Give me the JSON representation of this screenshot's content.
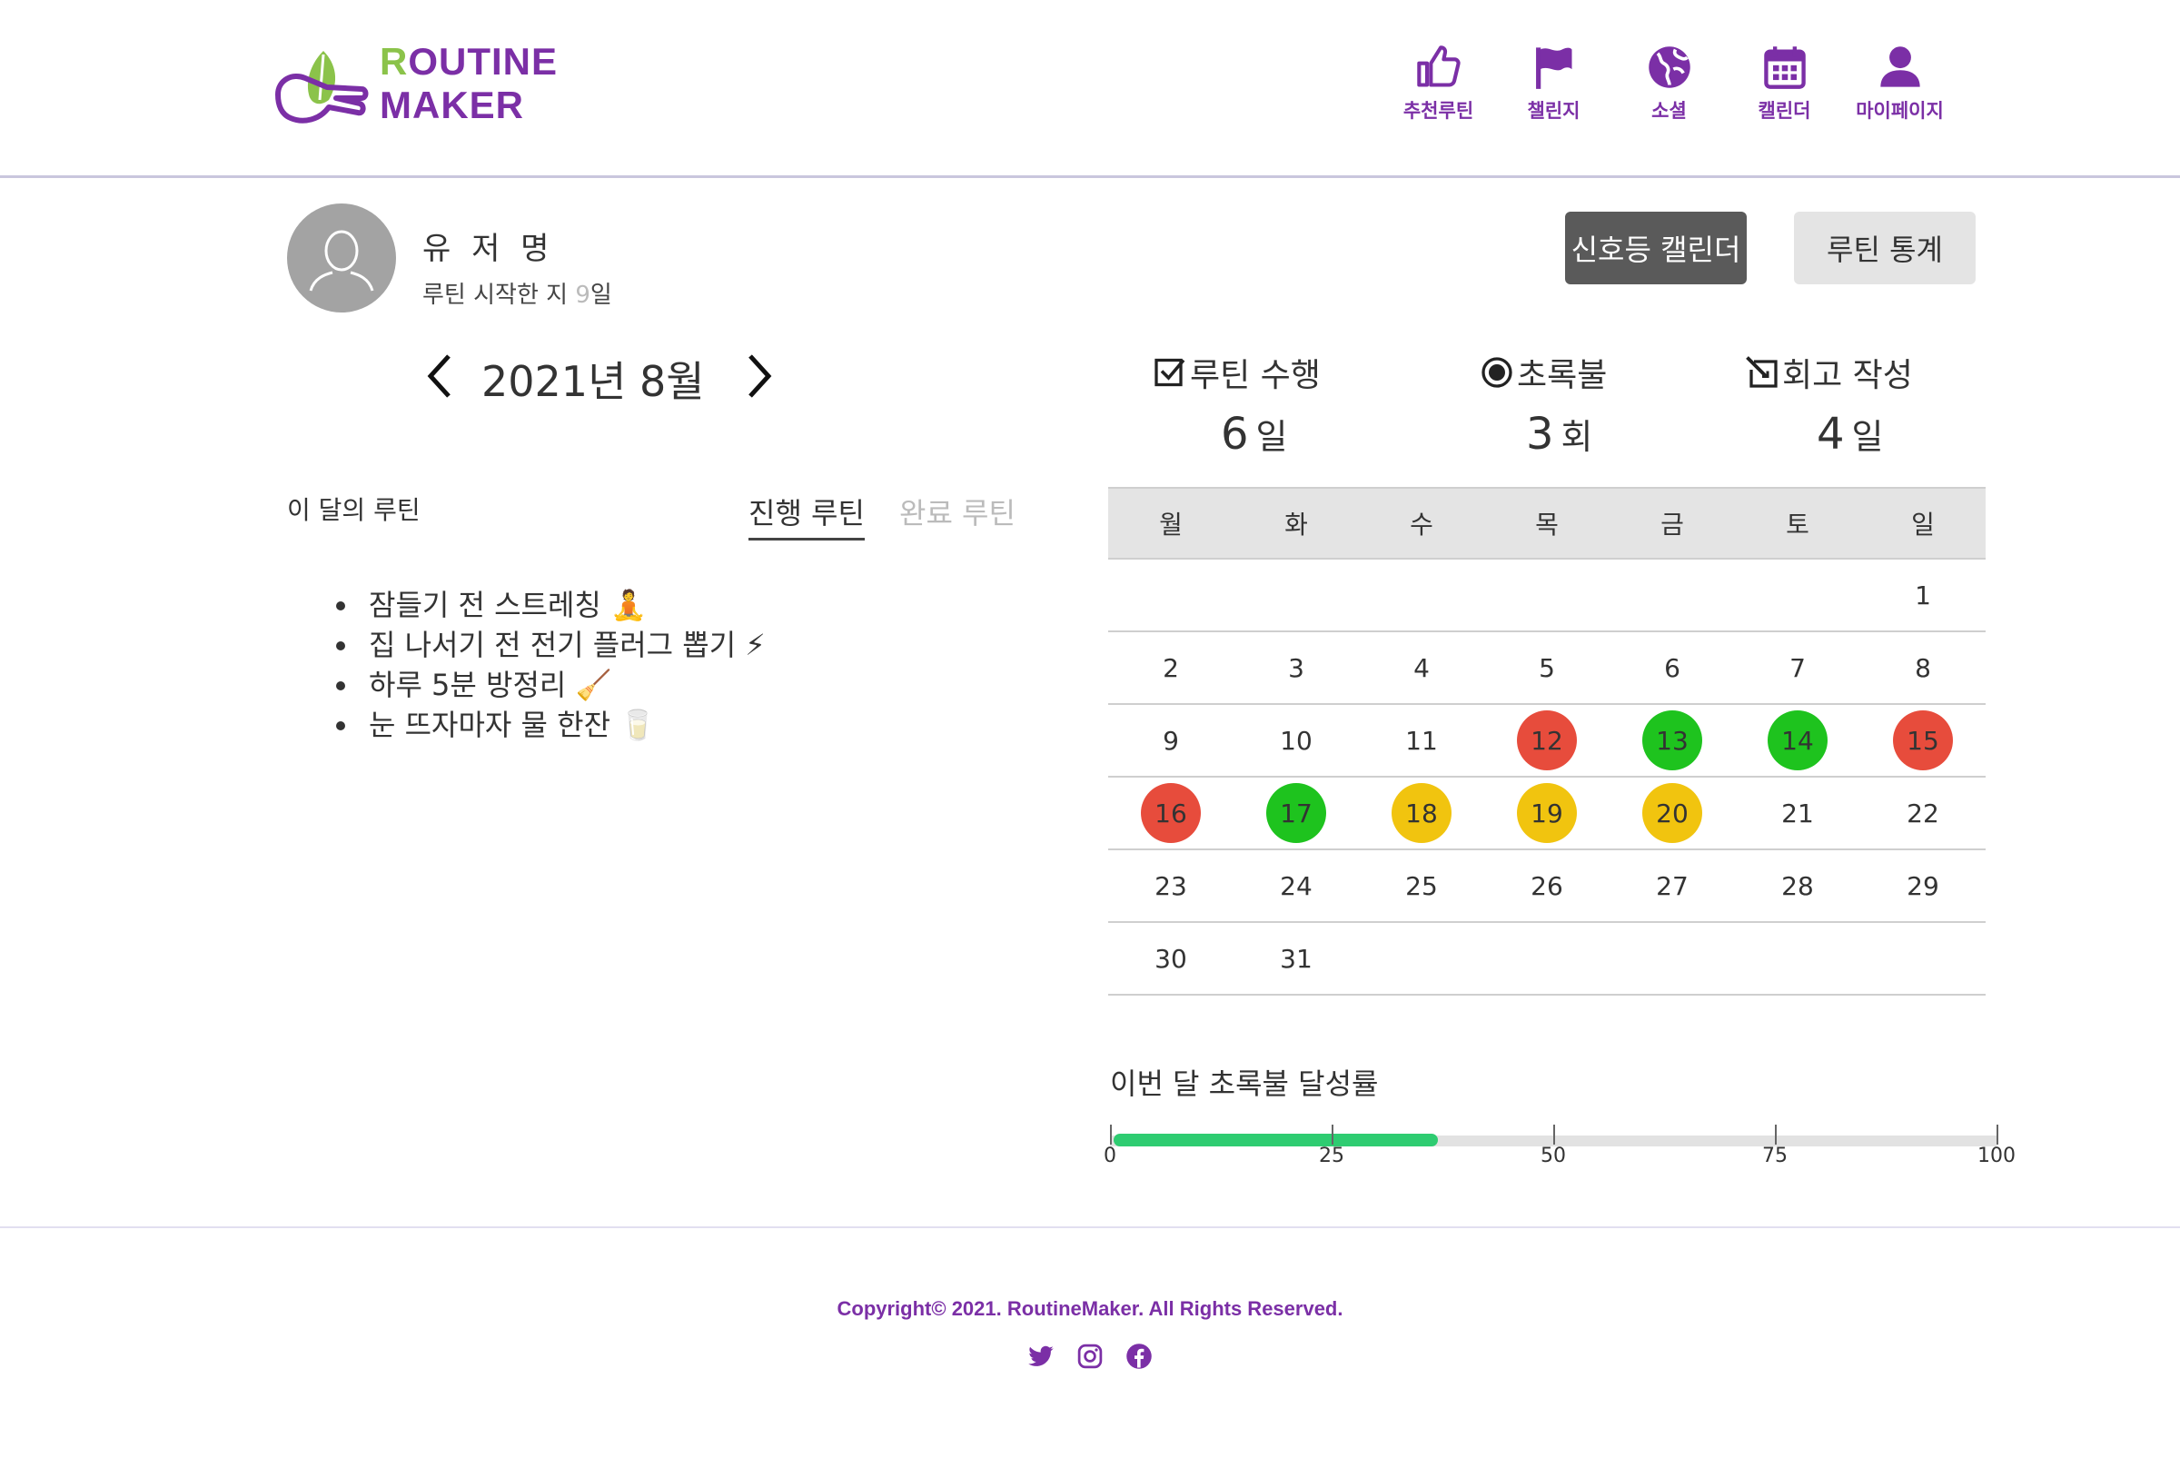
{
  "logo": {
    "line1_first": "R",
    "line1_rest": "OUTINE",
    "line2": "MAKER"
  },
  "nav": [
    {
      "label": "추천루틴",
      "icon": "thumbs-up-icon"
    },
    {
      "label": "챌린지",
      "icon": "flag-icon"
    },
    {
      "label": "소셜",
      "icon": "globe-icon"
    },
    {
      "label": "캘린더",
      "icon": "calendar-icon"
    },
    {
      "label": "마이페이지",
      "icon": "user-icon"
    }
  ],
  "profile": {
    "name": "유 저 명",
    "since_prefix": "루틴 시작한 지 ",
    "since_days": "9",
    "since_suffix": "일"
  },
  "buttons": {
    "signal_calendar": "신호등 캘린더",
    "routine_stats": "루틴 통계"
  },
  "month": {
    "title": "2021년 8월"
  },
  "stats": [
    {
      "label": "루틴 수행",
      "value": "6",
      "unit": "일",
      "icon": "checkbox-icon"
    },
    {
      "label": "초록불",
      "value": "3",
      "unit": "회",
      "icon": "radio-icon"
    },
    {
      "label": "회고 작성",
      "value": "4",
      "unit": "일",
      "icon": "edit-icon"
    }
  ],
  "routines": {
    "title": "이 달의 루틴",
    "tab_active": "진행 루틴",
    "tab_inactive": "완료 루틴",
    "items": [
      "잠들기 전 스트레칭 🧘",
      "집 나서기 전 전기 플러그 뽑기 ⚡",
      "하루 5분 방정리 🧹",
      "눈 뜨자마자 물 한잔 🥛"
    ]
  },
  "calendar": {
    "weekdays": [
      "월",
      "화",
      "수",
      "목",
      "금",
      "토",
      "일"
    ],
    "weeks": [
      [
        "",
        "",
        "",
        "",
        "",
        "",
        "1"
      ],
      [
        "2",
        "3",
        "4",
        "5",
        "6",
        "7",
        "8"
      ],
      [
        "9",
        "10",
        "11",
        "12",
        "13",
        "14",
        "15"
      ],
      [
        "16",
        "17",
        "18",
        "19",
        "20",
        "21",
        "22"
      ],
      [
        "23",
        "24",
        "25",
        "26",
        "27",
        "28",
        "29"
      ],
      [
        "30",
        "31",
        "",
        "",
        "",
        "",
        ""
      ]
    ],
    "day_status": {
      "12": "red",
      "13": "green",
      "14": "green",
      "15": "red",
      "16": "red",
      "17": "green",
      "18": "yellow",
      "19": "yellow",
      "20": "yellow"
    },
    "status_colors": {
      "red": "#e74c3c",
      "green": "#1ec31e",
      "yellow": "#f1c40f"
    }
  },
  "progress": {
    "title": "이번 달 초록불 달성률",
    "value": 37,
    "ticks": [
      "0",
      "25",
      "50",
      "75",
      "100"
    ],
    "fill_color": "#2ecc71"
  },
  "footer": {
    "copyright": "Copyright© 2021. RoutineMaker. All Rights Reserved.",
    "social": [
      "twitter-icon",
      "instagram-icon",
      "facebook-icon"
    ]
  },
  "colors": {
    "brand": "#7b2fa6",
    "brand_green": "#8bc34a"
  }
}
